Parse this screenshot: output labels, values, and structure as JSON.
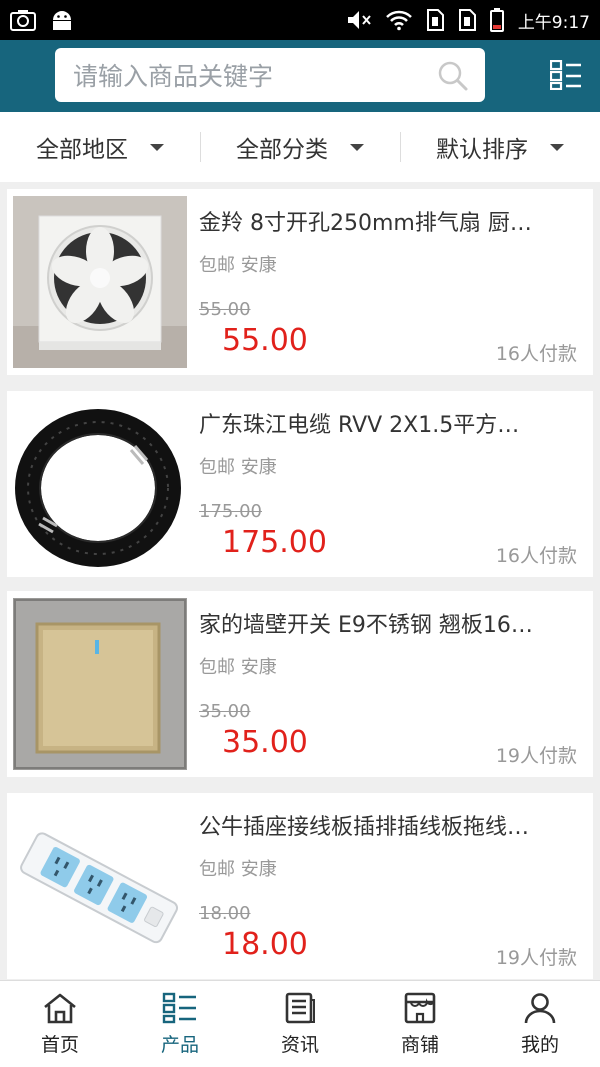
{
  "status_bar": {
    "time": "上午9:17"
  },
  "search": {
    "placeholder": "请输入商品关键字"
  },
  "filters": [
    {
      "label": "全部地区"
    },
    {
      "label": "全部分类"
    },
    {
      "label": "默认排序"
    }
  ],
  "products": [
    {
      "title": "金羚 8寸开孔250mm排气扇 厨…",
      "tags": "包邮 安康",
      "old_price": "55.00",
      "price": "55.00",
      "sold": "16人付款",
      "image": "exhaust-fan"
    },
    {
      "title": "广东珠江电缆 RVV 2X1.5平方…",
      "tags": "包邮 安康",
      "old_price": "175.00",
      "price": "175.00",
      "sold": "16人付款",
      "image": "cable-coil"
    },
    {
      "title": "家的墙壁开关 E9不锈钢 翘板16…",
      "tags": "包邮 安康",
      "old_price": "35.00",
      "price": "35.00",
      "sold": "19人付款",
      "image": "wall-switch"
    },
    {
      "title": "公牛插座接线板插排插线板拖线…",
      "tags": "包邮 安康",
      "old_price": "18.00",
      "price": "18.00",
      "sold": "19人付款",
      "image": "power-strip"
    }
  ],
  "tabs": [
    {
      "label": "首页",
      "icon": "home-icon"
    },
    {
      "label": "产品",
      "icon": "product-grid-icon",
      "active": true
    },
    {
      "label": "资讯",
      "icon": "news-icon"
    },
    {
      "label": "商铺",
      "icon": "store-icon"
    },
    {
      "label": "我的",
      "icon": "user-icon"
    }
  ],
  "colors": {
    "header": "#17657d",
    "price": "#e1211b",
    "active_tab": "#17657d"
  }
}
